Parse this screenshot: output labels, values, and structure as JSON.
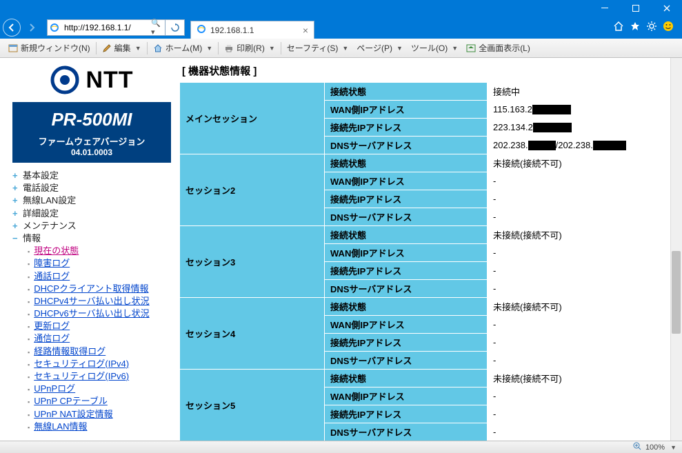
{
  "titlebar": {},
  "navbar": {
    "url": "http://192.168.1.1/",
    "tab_title": "192.168.1.1"
  },
  "toolbar": {
    "new_window": "新規ウィンドウ(N)",
    "edit": "編集",
    "home": "ホーム(M)",
    "print": "印刷(R)",
    "safety": "セーフティ(S)",
    "page": "ページ(P)",
    "tools": "ツール(O)",
    "fullscreen": "全画面表示(L)"
  },
  "sidebar": {
    "brand": "NTT",
    "model": "PR-500MI",
    "fw_label": "ファームウェアバージョン",
    "fw_version": "04.01.0003",
    "top": [
      "基本設定",
      "電話設定",
      "無線LAN設定",
      "詳細設定",
      "メンテナンス",
      "情報"
    ],
    "info_links": [
      "現在の状態",
      "障害ログ",
      "通話ログ",
      "DHCPクライアント取得情報",
      "DHCPv4サーバ払い出し状況",
      "DHCPv6サーバ払い出し状況",
      "更新ログ",
      "通信ログ",
      "経路情報取得ログ",
      "セキュリティログ(IPv4)",
      "セキュリティログ(IPv6)",
      "UPnPログ",
      "UPnP CPテーブル",
      "UPnP NAT設定情報",
      "無線LAN情報"
    ]
  },
  "main": {
    "title": "[ 機器状態情報 ]",
    "row_labels": [
      "接続状態",
      "WAN側IPアドレス",
      "接続先IPアドレス",
      "DNSサーバアドレス"
    ],
    "sessions": [
      {
        "name": "メインセッション",
        "values": [
          "接続中",
          "115.163.2",
          "223.134.2",
          ""
        ],
        "masked": [
          false,
          true,
          true,
          false
        ],
        "dns_prefix1": "202.238.",
        "dns_prefix2": "/202.238."
      },
      {
        "name": "セッション2",
        "values": [
          "未接続(接続不可)",
          "-",
          "-",
          "-"
        ],
        "masked": [
          false,
          false,
          false,
          false
        ]
      },
      {
        "name": "セッション3",
        "values": [
          "未接続(接続不可)",
          "-",
          "-",
          "-"
        ],
        "masked": [
          false,
          false,
          false,
          false
        ]
      },
      {
        "name": "セッション4",
        "values": [
          "未接続(接続不可)",
          "-",
          "-",
          "-"
        ],
        "masked": [
          false,
          false,
          false,
          false
        ]
      },
      {
        "name": "セッション5",
        "values": [
          "未接続(接続不可)",
          "-",
          "-",
          "-"
        ],
        "masked": [
          false,
          false,
          false,
          false
        ]
      }
    ]
  },
  "statusbar": {
    "zoom": "100%"
  }
}
